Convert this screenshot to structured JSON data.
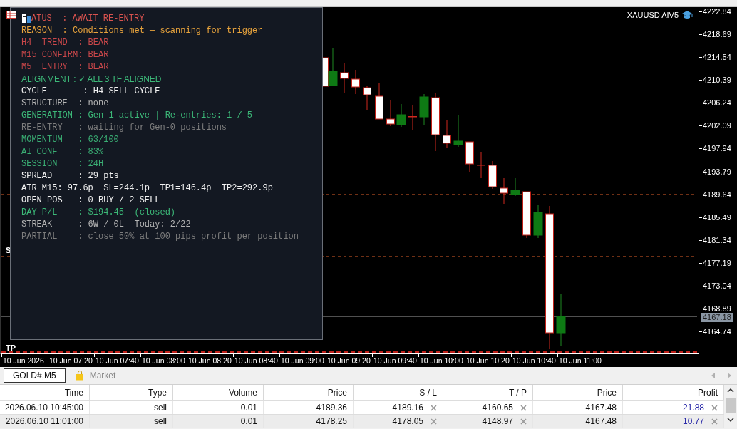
{
  "chart": {
    "symbol": "XAUUSD AIV5",
    "price_labels": [
      "4222.84",
      "4218.69",
      "4214.54",
      "4210.39",
      "4206.24",
      "4202.09",
      "4197.94",
      "4193.79",
      "4189.64",
      "4185.49",
      "4181.34",
      "4177.19",
      "4173.04",
      "4168.89",
      "4164.74"
    ],
    "current_price": "4167.18",
    "time_labels": [
      "10 Jun 2026",
      "10 Jun 07:20",
      "10 Jun 07:40",
      "10 Jun 08:00",
      "10 Jun 08:20",
      "10 Jun 08:40",
      "10 Jun 09:00",
      "10 Jun 09:20",
      "10 Jun 09:40",
      "10 Jun 10:00",
      "10 Jun 10:20",
      "10 Jun 10:40",
      "10 Jun 11:00"
    ],
    "line_labels": [
      "S",
      "TP"
    ]
  },
  "panel": {
    "lines": [
      {
        "kind": "icon-led",
        "text": "ATUS  : AWAIT RE-ENTRY",
        "color": "#d9534f"
      },
      {
        "kind": "mono",
        "text": "REASON  : Conditions met — scanning for trigger",
        "color": "#e8a33c"
      },
      {
        "kind": "mono",
        "text": "H4  TREND  : BEAR",
        "color": "#c9474a"
      },
      {
        "kind": "mono",
        "text": "M15 CONFIRM: BEAR",
        "color": "#c9474a"
      },
      {
        "kind": "mono",
        "text": "M5  ENTRY  : BEAR",
        "color": "#c9474a"
      },
      {
        "kind": "sans",
        "text": "ALIGNMENT : ✓ ALL 3 TF ALIGNED",
        "color": "#3cb878"
      },
      {
        "kind": "mono",
        "text": "CYCLE       : H4 SELL CYCLE",
        "color": "#f2f2f2"
      },
      {
        "kind": "mono",
        "text": "STRUCTURE  : none",
        "color": "#b4b4b4"
      },
      {
        "kind": "mono",
        "text": "GENERATION : Gen 1 active | Re-entries: 1 / 5",
        "color": "#3cb878"
      },
      {
        "kind": "mono",
        "text": "RE-ENTRY   : waiting for Gen-0 positions",
        "color": "#7d7d7d"
      },
      {
        "kind": "mono",
        "text": "MOMENTUM   : 63/100",
        "color": "#3aae74"
      },
      {
        "kind": "mono",
        "text": "AI CONF    : 83%",
        "color": "#3aae74"
      },
      {
        "kind": "mono",
        "text": "SESSION    : 24H",
        "color": "#3aae74"
      },
      {
        "kind": "mono",
        "text": "SPREAD     : 29 pts",
        "color": "#f2f2f2"
      },
      {
        "kind": "mono",
        "text": "ATR M15: 97.6p  SL=244.1p  TP1=146.4p  TP2=292.9p",
        "color": "#f2f2f2"
      },
      {
        "kind": "mono",
        "text": "OPEN POS   : 0 BUY / 2 SELL",
        "color": "#f2f2f2"
      },
      {
        "kind": "mono",
        "text": "DAY P/L    : $194.45  (closed)",
        "color": "#3cb878"
      },
      {
        "kind": "mono",
        "text": "STREAK     : 6W / 0L  Today: 2/22",
        "color": "#b4b4b4"
      },
      {
        "kind": "mono",
        "text": "PARTIAL    : close 50% at 100 pips profit per position",
        "color": "#7d7d7d"
      }
    ]
  },
  "tabs": [
    {
      "kind": "chart",
      "label": "GOLD#,M5",
      "selected": true
    },
    {
      "kind": "market",
      "label": "Market",
      "selected": false
    }
  ],
  "table": {
    "columns": [
      "Time",
      "Type",
      "Volume",
      "Price",
      "S / L",
      "T / P",
      "Price",
      "Profit"
    ],
    "rows": [
      {
        "cells": [
          "2026.06.10 10:45:00",
          "sell",
          "0.01",
          "4189.36",
          "4189.16",
          "4160.65",
          "4167.48",
          "21.88"
        ]
      },
      {
        "cells": [
          "2026.06.10 11:01:00",
          "sell",
          "0.01",
          "4178.25",
          "4178.05",
          "4148.97",
          "4167.48",
          "10.77"
        ]
      }
    ]
  }
}
